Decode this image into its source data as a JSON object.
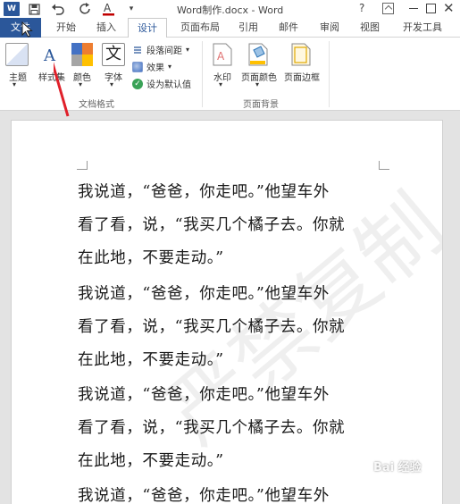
{
  "window": {
    "app_badge": "W",
    "title": "Word制作.docx - Word",
    "help": "?",
    "close": "✕"
  },
  "tabs": [
    "文件",
    "开始",
    "插入",
    "设计",
    "页面布局",
    "引用",
    "邮件",
    "审阅",
    "视图",
    "开发工具"
  ],
  "ribbon": {
    "theme": "主题",
    "style_set": "样式集",
    "colors": "颜色",
    "fonts": "字体",
    "font_icon_letter": "文",
    "para_spacing": "段落间距",
    "effects": "效果",
    "set_default": "设为默认值",
    "group_doc_format": "文档格式",
    "watermark": "水印",
    "page_color": "页面颜色",
    "page_border": "页面边框",
    "group_page_bg": "页面背景"
  },
  "document": {
    "lines": [
      "我说道，“爸爸，你走吧。”他望车外",
      "看了看，说，“我买几个橘子去。你就",
      "在此地，不要走动。”",
      "我说道，“爸爸，你走吧。”他望车外",
      "看了看，说，“我买几个橘子去。你就",
      "在此地，不要走动。”",
      "我说道，“爸爸，你走吧。”他望车外",
      "看了看，说，“我买几个橘子去。你就",
      "在此地，不要走动。”",
      "我说道，“爸爸，你走吧。”他望车外"
    ],
    "watermark_text": "严禁复制"
  },
  "overlay": {
    "site_watermark": "Bai 经验"
  },
  "colors": {
    "accent": "#2b579a",
    "arrow": "#e0202a"
  }
}
